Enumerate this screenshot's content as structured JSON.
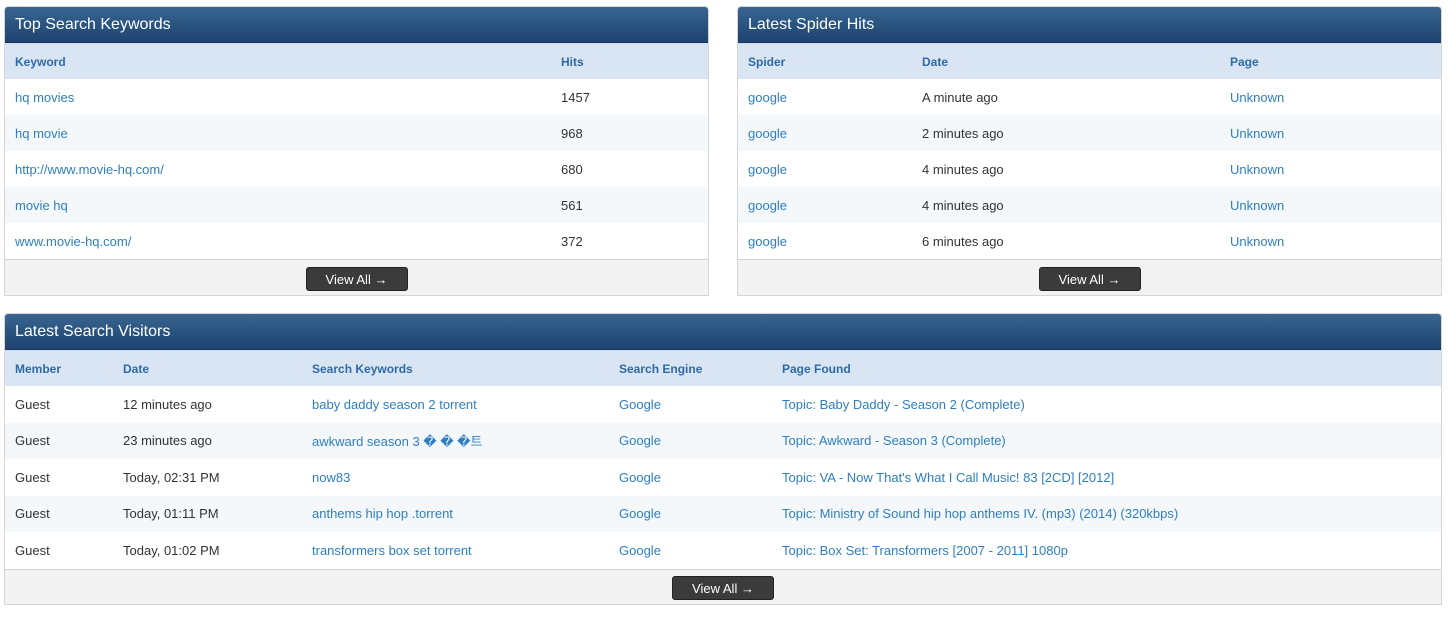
{
  "keywords_panel": {
    "title": "Top Search Keywords",
    "columns": [
      "Keyword",
      "Hits"
    ],
    "rows": [
      {
        "keyword": "hq movies",
        "hits": "1457"
      },
      {
        "keyword": "hq movie",
        "hits": "968"
      },
      {
        "keyword": "http://www.movie-hq.com/",
        "hits": "680"
      },
      {
        "keyword": "movie hq",
        "hits": "561"
      },
      {
        "keyword": "www.movie-hq.com/",
        "hits": "372"
      }
    ],
    "view_all_label": "View All →"
  },
  "spider_panel": {
    "title": "Latest Spider Hits",
    "columns": [
      "Spider",
      "Date",
      "Page"
    ],
    "rows": [
      {
        "spider": "google",
        "date": "A minute ago",
        "page": "Unknown"
      },
      {
        "spider": "google",
        "date": "2 minutes ago",
        "page": "Unknown"
      },
      {
        "spider": "google",
        "date": "4 minutes ago",
        "page": "Unknown"
      },
      {
        "spider": "google",
        "date": "4 minutes ago",
        "page": "Unknown"
      },
      {
        "spider": "google",
        "date": "6 minutes ago",
        "page": "Unknown"
      }
    ],
    "view_all_label": "View All →"
  },
  "visitors_panel": {
    "title": "Latest Search Visitors",
    "columns": [
      "Member",
      "Date",
      "Search Keywords",
      "Search Engine",
      "Page Found"
    ],
    "rows": [
      {
        "member": "Guest",
        "date": "12 minutes ago",
        "keywords": "baby daddy season 2 torrent",
        "engine": "Google",
        "page": "Topic: Baby Daddy - Season 2 (Complete)"
      },
      {
        "member": "Guest",
        "date": "23 minutes ago",
        "keywords": "awkward season 3 � � �트",
        "engine": "Google",
        "page": "Topic: Awkward - Season 3 (Complete)"
      },
      {
        "member": "Guest",
        "date": "Today, 02:31 PM",
        "keywords": "now83",
        "engine": "Google",
        "page": "Topic: VA - Now That's What I Call Music! 83 [2CD] [2012]"
      },
      {
        "member": "Guest",
        "date": "Today, 01:11 PM",
        "keywords": "anthems hip hop .torrent",
        "engine": "Google",
        "page": "Topic: Ministry of Sound hip hop anthems IV. (mp3) (2014) (320kbps)"
      },
      {
        "member": "Guest",
        "date": "Today, 01:02 PM",
        "keywords": "transformers box set torrent",
        "engine": "Google",
        "page": "Topic: Box Set: Transformers [2007 - 2011] 1080p"
      }
    ],
    "view_all_label": "View All →"
  }
}
